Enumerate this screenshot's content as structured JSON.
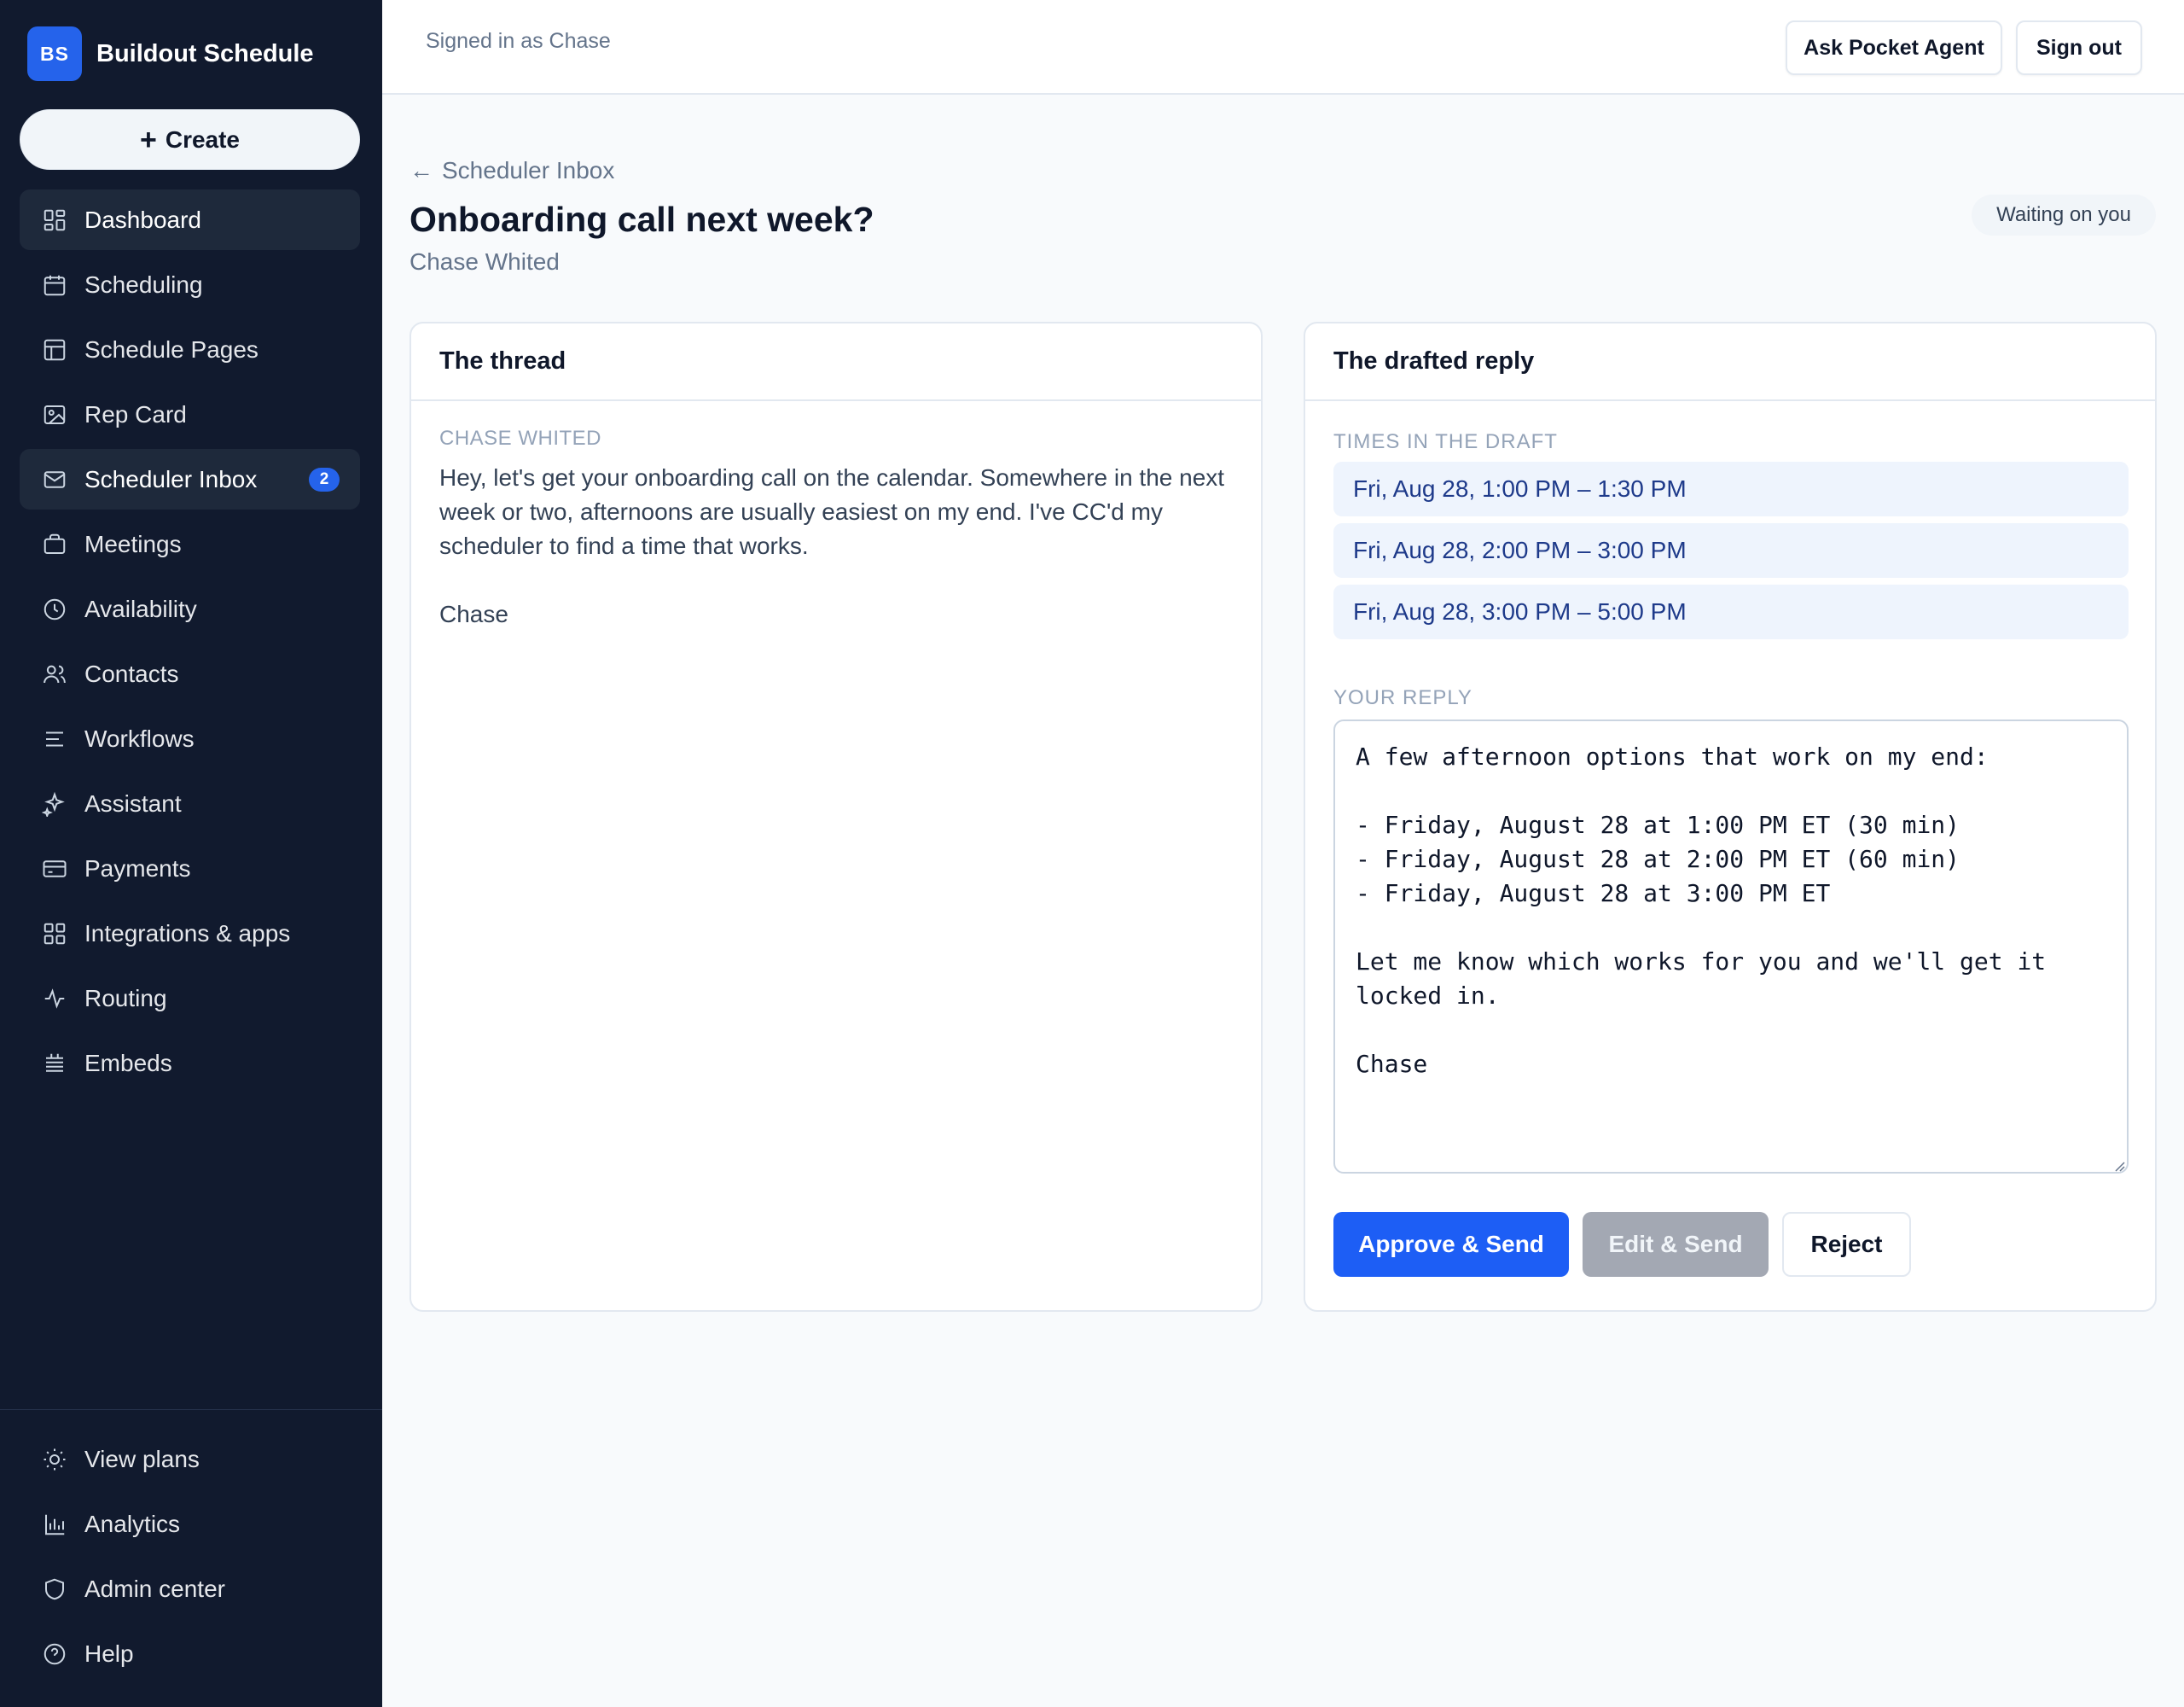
{
  "app": {
    "logo_initials": "BS",
    "name": "Buildout Schedule"
  },
  "sidebar": {
    "create_label": "Create",
    "items": [
      {
        "label": "Dashboard",
        "icon": "dashboard-icon",
        "active": true
      },
      {
        "label": "Scheduling",
        "icon": "calendar-icon"
      },
      {
        "label": "Schedule Pages",
        "icon": "layout-icon"
      },
      {
        "label": "Rep Card",
        "icon": "image-icon"
      },
      {
        "label": "Scheduler Inbox",
        "icon": "mail-icon",
        "active": true,
        "badge": "2"
      },
      {
        "label": "Meetings",
        "icon": "briefcase-icon"
      },
      {
        "label": "Availability",
        "icon": "clock-icon"
      },
      {
        "label": "Contacts",
        "icon": "users-icon"
      },
      {
        "label": "Workflows",
        "icon": "list-icon"
      },
      {
        "label": "Assistant",
        "icon": "sparkles-icon"
      },
      {
        "label": "Payments",
        "icon": "credit-card-icon"
      },
      {
        "label": "Integrations & apps",
        "icon": "grid-icon"
      },
      {
        "label": "Routing",
        "icon": "activity-icon"
      },
      {
        "label": "Embeds",
        "icon": "embed-icon"
      }
    ],
    "bottom_items": [
      {
        "label": "View plans",
        "icon": "sun-icon"
      },
      {
        "label": "Analytics",
        "icon": "bar-chart-icon"
      },
      {
        "label": "Admin center",
        "icon": "shield-icon"
      },
      {
        "label": "Help",
        "icon": "help-icon"
      }
    ]
  },
  "topbar": {
    "signed_in": "Signed in as Chase",
    "ask_agent": "Ask Pocket Agent",
    "sign_out": "Sign out"
  },
  "header": {
    "back": "Scheduler Inbox",
    "title": "Onboarding call next week?",
    "subtitle": "Chase Whited",
    "status": "Waiting on you"
  },
  "thread": {
    "title": "The thread",
    "sender": "CHASE WHITED",
    "message": "Hey, let's get your onboarding call on the calendar. Somewhere in the next\nweek or two, afternoons are usually easiest on my end. I've CC'd my scheduler to find a time that works.\n\nChase"
  },
  "draft": {
    "title": "The drafted reply",
    "times_label": "TIMES IN THE DRAFT",
    "times": [
      "Fri, Aug 28, 1:00 PM – 1:30 PM",
      "Fri, Aug 28, 2:00 PM – 3:00 PM",
      "Fri, Aug 28, 3:00 PM – 5:00 PM"
    ],
    "reply_label": "YOUR REPLY",
    "reply_text": "A few afternoon options that work on my end:\n\n- Friday, August 28 at 1:00 PM ET (30 min)\n- Friday, August 28 at 2:00 PM ET (60 min)\n- Friday, August 28 at 3:00 PM ET\n\nLet me know which works for you and we'll get it locked in.\n\nChase",
    "approve": "Approve & Send",
    "edit": "Edit & Send",
    "reject": "Reject"
  }
}
